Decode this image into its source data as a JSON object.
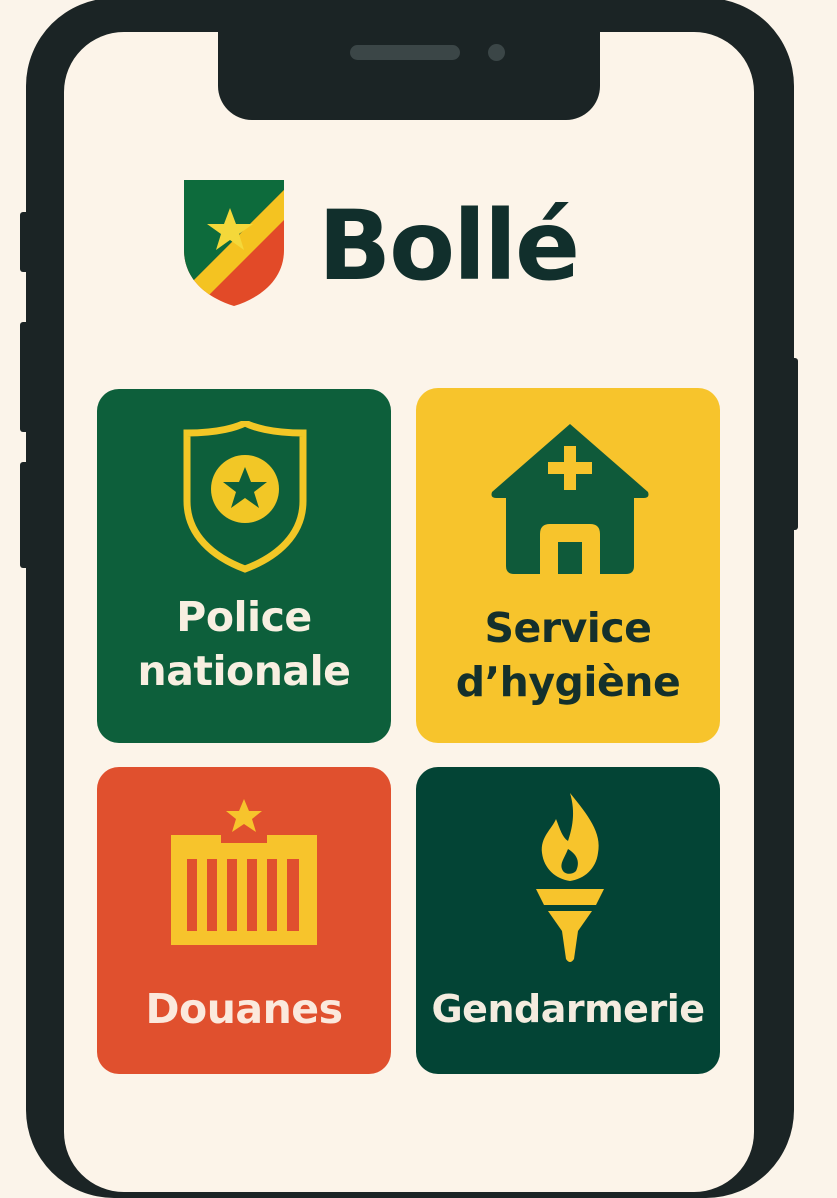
{
  "app": {
    "name": "Bollé",
    "logo_icon": "flag-shield-icon"
  },
  "services": [
    {
      "id": "police",
      "label_lines": [
        "Police",
        "nationale"
      ],
      "icon": "police-shield-star-icon",
      "color": "#0d5f3b"
    },
    {
      "id": "hygiene",
      "label_lines": [
        "Service",
        "d’hygiène"
      ],
      "icon": "house-cross-icon",
      "color": "#f7c42c"
    },
    {
      "id": "douanes",
      "label_lines": [
        "Douanes"
      ],
      "icon": "customs-barrier-star-icon",
      "color": "#e0502e"
    },
    {
      "id": "gendarmerie",
      "label_lines": [
        "Gendarmerie"
      ],
      "icon": "torch-icon",
      "color": "#034435"
    }
  ],
  "colors": {
    "background": "#fbf4ea",
    "phone_frame": "#1b2425",
    "text_dark": "#112f2c",
    "accent_yellow": "#f7c42c",
    "accent_green": "#0d5f3b",
    "accent_red": "#e0502e"
  }
}
